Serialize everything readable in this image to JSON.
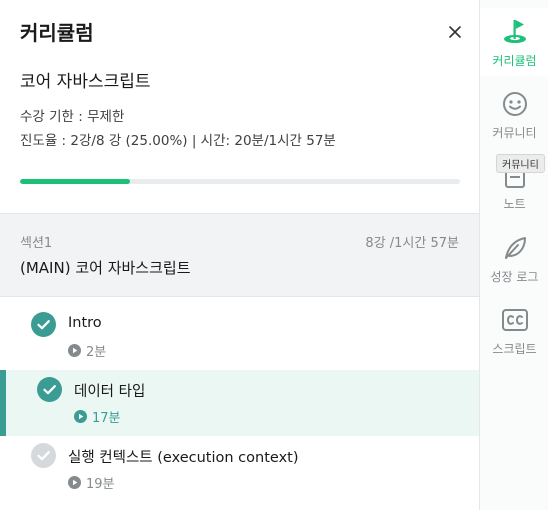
{
  "panel": {
    "title": "커리큘럼"
  },
  "course": {
    "title": "코어 자바스크립트",
    "period_line": "수강 기한 : 무제한",
    "progress_line": "진도율 : 2강/8 강 (25.00%) | 시간: 20분/1시간 57분",
    "progress_fraction": 0.25
  },
  "section": {
    "label": "섹션1",
    "meta": "8강 /1시간 57분",
    "title": "(MAIN) 코어 자바스크립트"
  },
  "lessons": [
    {
      "title": "Intro",
      "duration": "2분",
      "state": "done"
    },
    {
      "title": "데이터 타입",
      "duration": "17분",
      "state": "done",
      "active": true
    },
    {
      "title": "실행 컨텍스트 (execution context)",
      "duration": "19분",
      "state": "todo"
    }
  ],
  "sidebar": {
    "items": [
      {
        "label": "커리큘럼",
        "icon": "flag-icon",
        "active": true
      },
      {
        "label": "커뮤니티",
        "icon": "smile-icon"
      },
      {
        "label": "노트",
        "icon": "note-icon"
      },
      {
        "label": "성장 로그",
        "icon": "leaf-icon"
      },
      {
        "label": "스크립트",
        "icon": "cc-icon"
      }
    ],
    "tooltip": "커뮤니티"
  },
  "colors": {
    "accent": "#1dc078",
    "teal": "#3a9c92",
    "muted": "#858a8d"
  }
}
